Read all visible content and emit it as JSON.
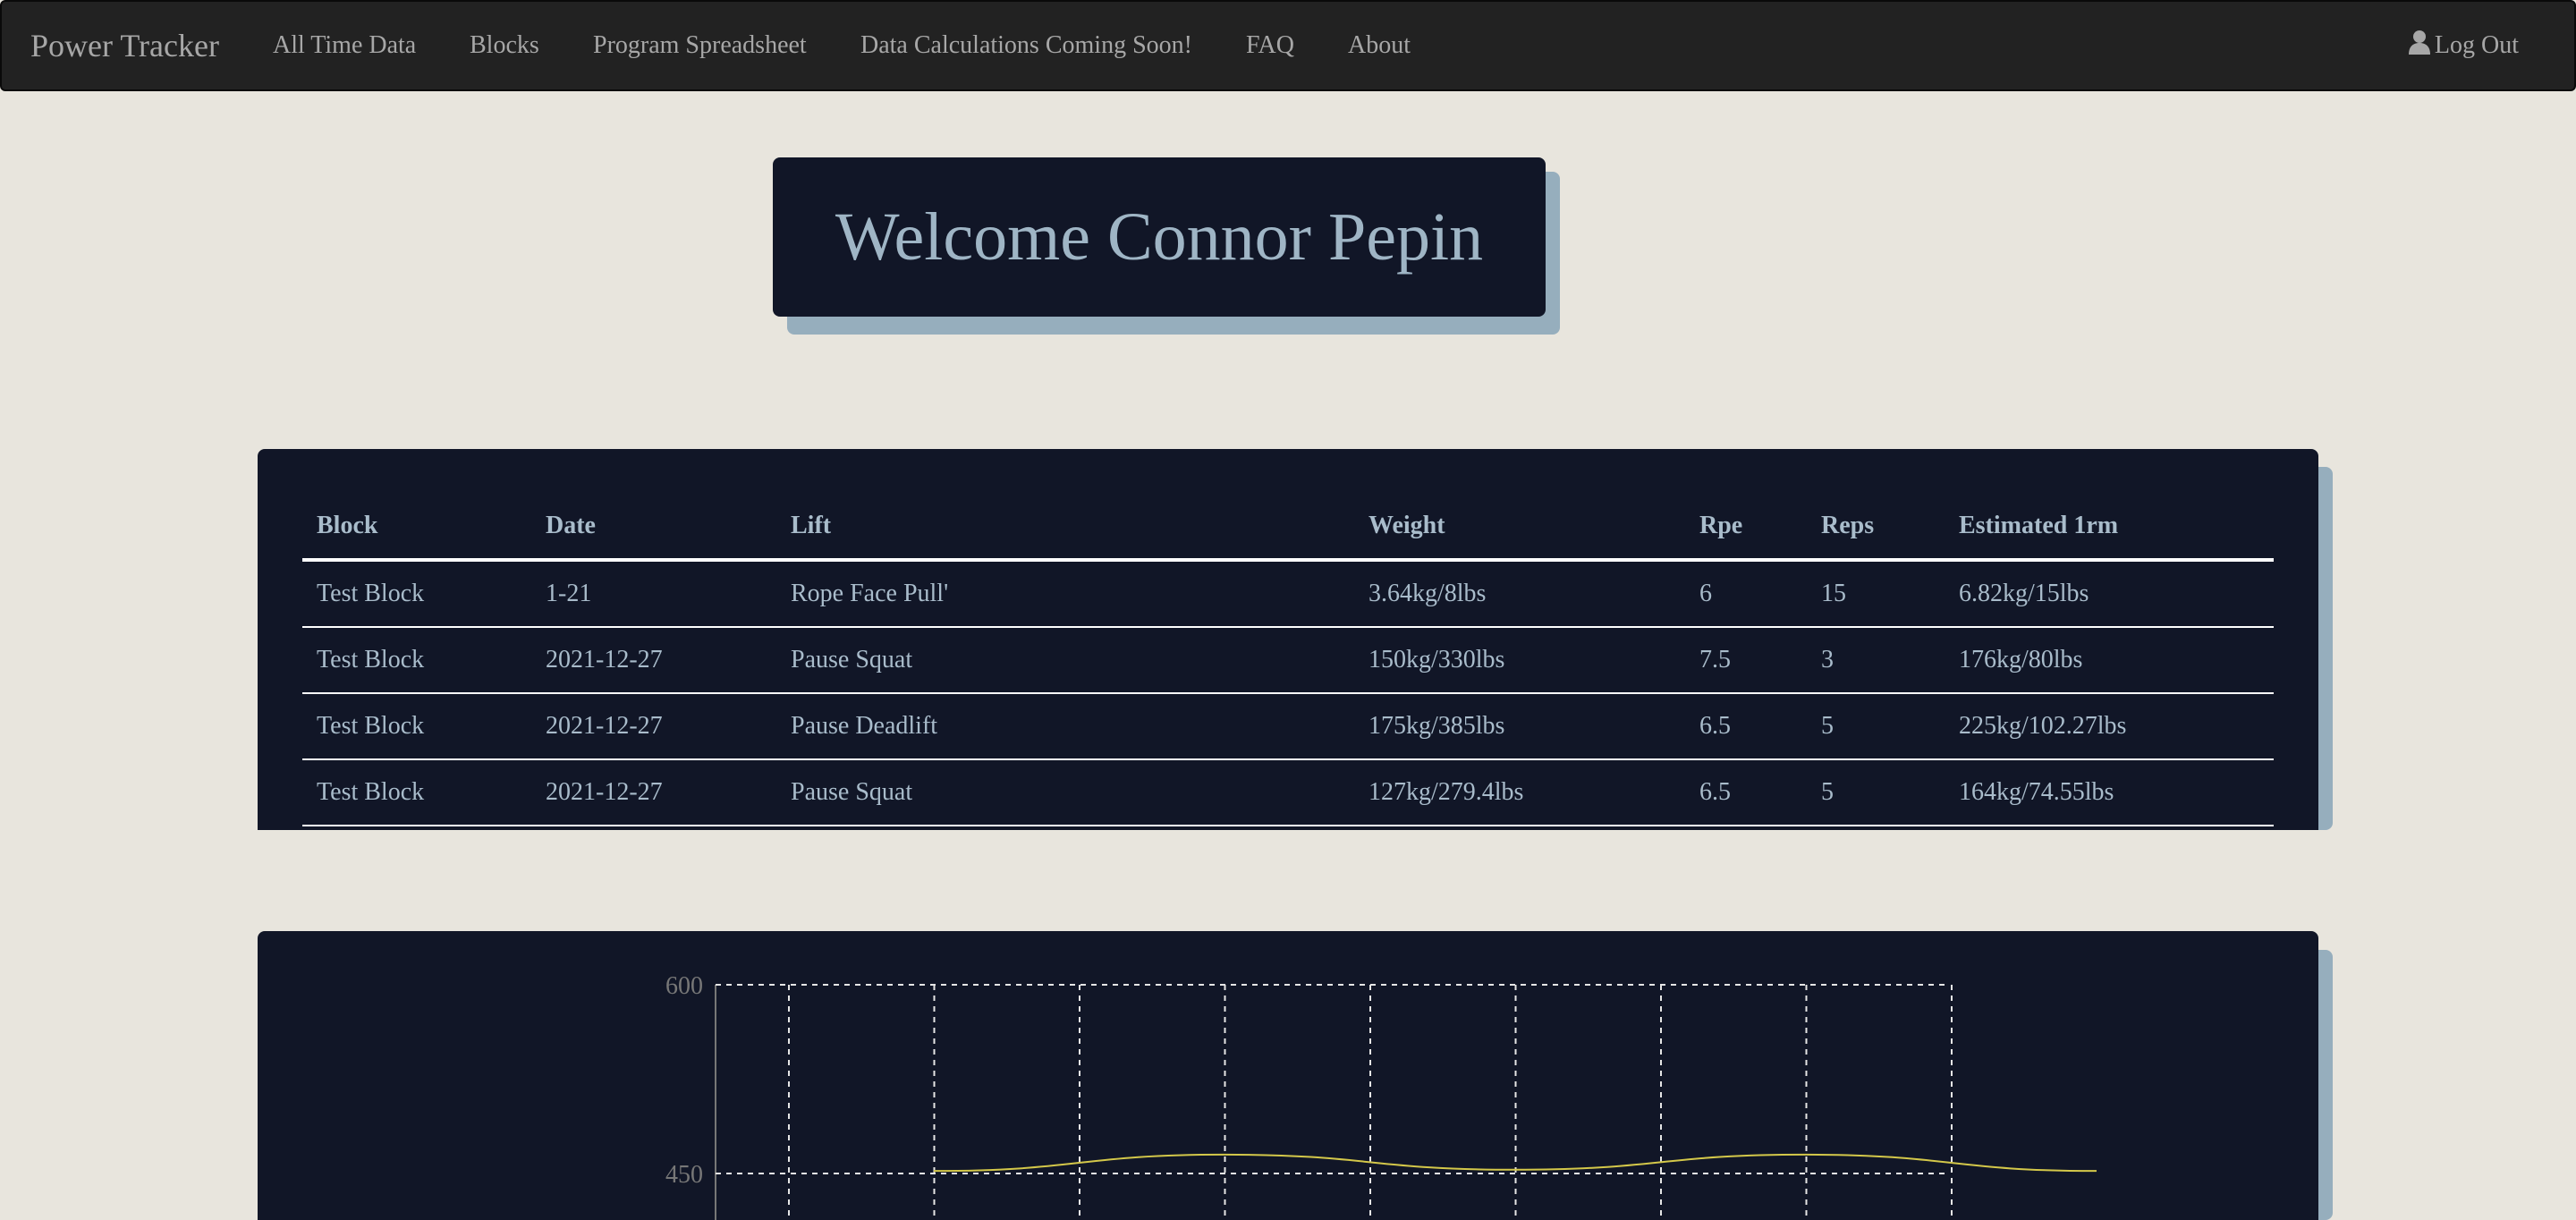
{
  "navbar": {
    "brand": "Power Tracker",
    "links": [
      {
        "label": "All Time Data"
      },
      {
        "label": "Blocks"
      },
      {
        "label": "Program Spreadsheet"
      },
      {
        "label": "Data Calculations Coming Soon!"
      },
      {
        "label": "FAQ"
      },
      {
        "label": "About"
      }
    ],
    "logout_label": "Log Out",
    "logout_icon": "user-icon"
  },
  "welcome": {
    "title": "Welcome Connor Pepin"
  },
  "table": {
    "headers": [
      "Block",
      "Date",
      "Lift",
      "Weight",
      "Rpe",
      "Reps",
      "Estimated 1rm"
    ],
    "rows": [
      [
        "Test Block",
        "1-21",
        "Rope Face Pull'",
        "3.64kg/8lbs",
        "6",
        "15",
        "6.82kg/15lbs"
      ],
      [
        "Test Block",
        "2021-12-27",
        "Pause Squat",
        "150kg/330lbs",
        "7.5",
        "3",
        "176kg/80lbs"
      ],
      [
        "Test Block",
        "2021-12-27",
        "Pause Deadlift",
        "175kg/385lbs",
        "6.5",
        "5",
        "225kg/102.27lbs"
      ],
      [
        "Test Block",
        "2021-12-27",
        "Pause Squat",
        "127kg/279.4lbs",
        "6.5",
        "5",
        "164kg/74.55lbs"
      ]
    ]
  },
  "colors": {
    "background": "#e8e5dd",
    "navbar": "#222222",
    "panel": "#111627",
    "accent_shadow": "#96aebd",
    "text": "#a9bccb",
    "line": "#d4c84a"
  },
  "chart_data": {
    "type": "line",
    "ylim": [
      0,
      600
    ],
    "y_ticks_visible": [
      "600",
      "450"
    ],
    "x_gridlines": 9,
    "grid": true,
    "series": [
      {
        "points": [
          {
            "x": 1,
            "y": 452
          },
          {
            "x": 2,
            "y": 465
          },
          {
            "x": 3,
            "y": 453
          },
          {
            "x": 4,
            "y": 465
          },
          {
            "x": 5,
            "y": 452
          }
        ]
      }
    ]
  }
}
